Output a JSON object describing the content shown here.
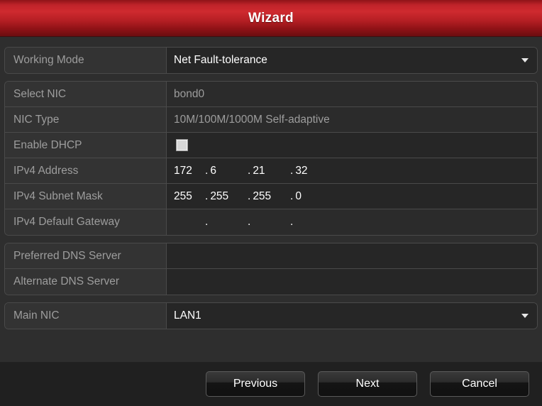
{
  "window": {
    "title": "Wizard",
    "title_bar_color": "#c0232a"
  },
  "form": {
    "groups": [
      {
        "name": "working-mode",
        "rows": [
          {
            "label": "Working Mode",
            "type": "dropdown",
            "value": "Net Fault-tolerance",
            "icon": "chevron-down-icon"
          }
        ]
      },
      {
        "name": "nic-settings",
        "rows": [
          {
            "label": "Select NIC",
            "type": "readonly-text",
            "value": "bond0"
          },
          {
            "label": "NIC Type",
            "type": "readonly-text",
            "value": "10M/100M/1000M Self-adaptive"
          },
          {
            "label": "Enable DHCP",
            "type": "checkbox",
            "checked": false,
            "icon": "checkbox-icon"
          },
          {
            "label": "IPv4 Address",
            "type": "ip",
            "octets": [
              "172",
              "6",
              "21",
              "32"
            ]
          },
          {
            "label": "IPv4 Subnet Mask",
            "type": "ip",
            "octets": [
              "255",
              "255",
              "255",
              "0"
            ]
          },
          {
            "label": "IPv4 Default Gateway",
            "type": "ip",
            "octets": [
              "",
              "",
              "",
              ""
            ]
          }
        ]
      },
      {
        "name": "dns-settings",
        "rows": [
          {
            "label": "Preferred DNS Server",
            "type": "text",
            "value": ""
          },
          {
            "label": "Alternate DNS Server",
            "type": "text",
            "value": ""
          }
        ]
      },
      {
        "name": "main-nic",
        "rows": [
          {
            "label": "Main NIC",
            "type": "dropdown",
            "value": "LAN1",
            "icon": "chevron-down-icon"
          }
        ]
      }
    ]
  },
  "footer": {
    "buttons": [
      {
        "name": "previous-button",
        "label": "Previous"
      },
      {
        "name": "next-button",
        "label": "Next"
      },
      {
        "name": "cancel-button",
        "label": "Cancel"
      }
    ]
  }
}
